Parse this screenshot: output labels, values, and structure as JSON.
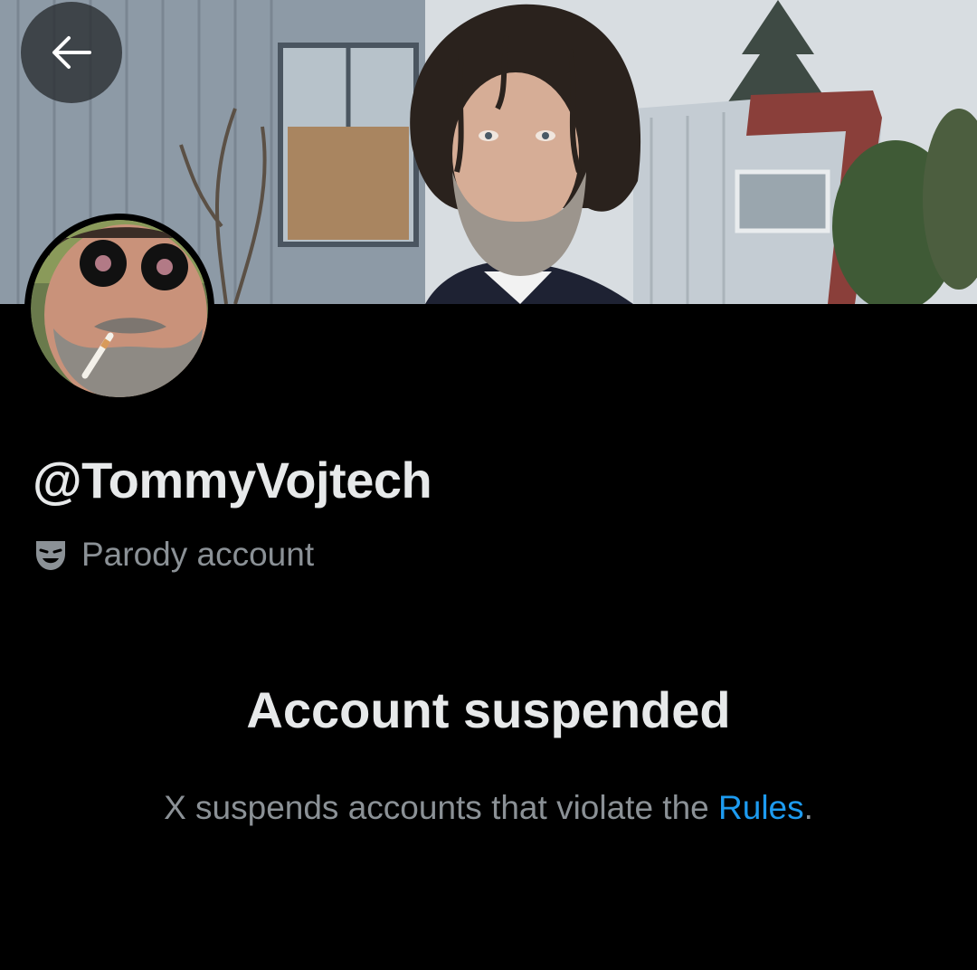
{
  "header": {
    "back_icon": "arrow-left-icon"
  },
  "profile": {
    "handle": "@TommyVojtech",
    "label_icon": "theater-mask-icon",
    "label_text": "Parody account"
  },
  "suspension": {
    "title": "Account suspended",
    "message_prefix": "X suspends accounts that violate the ",
    "rules_link": "Rules",
    "message_suffix": "."
  },
  "colors": {
    "background": "#000000",
    "primary_text": "#e7e9ea",
    "secondary_text": "#8b9196",
    "link": "#1d9bf0"
  }
}
